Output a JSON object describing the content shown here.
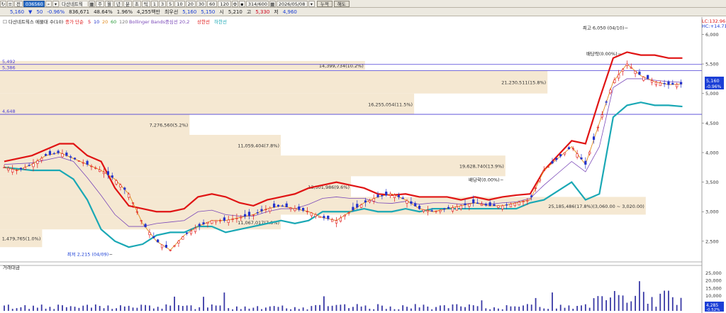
{
  "toolbar": {
    "row1": {
      "period_buttons": [
        "주",
        "월",
        "년",
        "분",
        "초",
        "틱"
      ],
      "interval_buttons": [
        "1",
        "3",
        "5",
        "10",
        "20",
        "30",
        "60",
        "120"
      ],
      "count": "314/600",
      "date": "2026/05/08",
      "btn_sum": "누적",
      "btn_apply": "적용",
      "btn_clear": "해도",
      "stock_code": "036560",
      "stock_name": "다산네트웍",
      "mode": "전"
    },
    "row2": {
      "price": "5,160",
      "change": "50",
      "change_pct": "-0.96%",
      "volume": "836,671",
      "ratio": "48.64%",
      "ratio2": "1.96%",
      "amount": "4,255백만",
      "label_prev": "최우선",
      "best_ask": "5,160",
      "best_bid": "5,150",
      "label_low": "시",
      "open": "5,210",
      "label_high": "고",
      "high": "5,330",
      "label_close": "저",
      "low": "4,960"
    }
  },
  "legend": {
    "title": "다산네트웍스 메물대 수(10)",
    "ma_label": "종가 단순",
    "ma_periods": [
      "5",
      "10",
      "20",
      "60",
      "120"
    ],
    "bb_label": "Bollinger Bands중심선 20,2",
    "bb_upper": "상한선",
    "bb_lower": "하한선"
  },
  "volume_label": "거래대금",
  "right_badges": {
    "top1": "LC:132.96",
    "top2": "HC:+14.71",
    "price": "5,160",
    "pct": "-0.96%",
    "vol_value": "4,285",
    "vol_pct": "-0.52%"
  },
  "colors": {
    "upper_band": "#e01414",
    "lower_band": "#1aa8b5",
    "candle_up": "#e01414",
    "candle_down": "#2233cc",
    "profile": "#f5e8d2",
    "hline": "#4b3fd6"
  },
  "chart_data": {
    "type": "candlestick",
    "y_ticks": [
      "6,000",
      "5,500",
      "5,000",
      "4,500",
      "4,000",
      "3,500",
      "3,000",
      "2,500"
    ],
    "y_range": [
      2150,
      6150
    ],
    "vol_ticks": [
      "25,000",
      "20,000",
      "15,000",
      "10,000",
      "5,000"
    ],
    "vol_range": [
      0,
      28000
    ],
    "hlines": [
      "5,492",
      "5,386",
      "4,648"
    ],
    "volume_profile": [
      {
        "price_top": 5550,
        "price_bot": 5400,
        "label": "14,399,734(10.2%)",
        "rel": 0.52
      },
      {
        "price_top": 5390,
        "price_bot": 5000,
        "label": "21,230,511(15.8%)",
        "rel": 0.78
      },
      {
        "price_top": 5000,
        "price_bot": 4650,
        "label": "16,255,054(11.5%)",
        "rel": 0.59
      },
      {
        "price_top": 4650,
        "price_bot": 4300,
        "label": "7,276,560(5.2%)",
        "rel": 0.27
      },
      {
        "price_top": 4300,
        "price_bot": 3950,
        "label": "11,059,404(7.8%)",
        "rel": 0.4
      },
      {
        "price_top": 3950,
        "price_bot": 3600,
        "label": "19,628,740(13.9%)",
        "rel": 0.72
      },
      {
        "price_top": 3600,
        "price_bot": 3250,
        "label": "13,501,986(9.6%)",
        "rel": 0.5
      },
      {
        "price_top": 3250,
        "price_bot": 2950,
        "label": "25,185,486(17.8%)(3,060.00 ~ 3,020.00)",
        "rel": 0.92
      },
      {
        "price_top": 2950,
        "price_bot": 2700,
        "label": "11,067,017(7.8%)",
        "rel": 0.4
      },
      {
        "price_top": 2700,
        "price_bot": 2400,
        "label": "1,479,765(1.0%)",
        "rel": 0.06
      }
    ],
    "annotations": [
      {
        "text": "최고 6,050 (04/10)",
        "price": 6050,
        "pos": 0.9
      },
      {
        "text": "최저 2,215 (04/09)",
        "price": 2215,
        "pos": 0.155
      },
      {
        "text": "배당락(0.00%)",
        "price": 5610,
        "pos": 0.89
      },
      {
        "text": "배당락(0.00%)",
        "price": 3480,
        "pos": 0.72
      }
    ],
    "price_path": [
      [
        0,
        3750
      ],
      [
        2,
        3700
      ],
      [
        4,
        3800
      ],
      [
        6,
        3950
      ],
      [
        8,
        4000
      ],
      [
        10,
        3900
      ],
      [
        12,
        3800
      ],
      [
        14,
        3700
      ],
      [
        16,
        3550
      ],
      [
        18,
        3300
      ],
      [
        20,
        2800
      ],
      [
        22,
        2500
      ],
      [
        24,
        2350
      ],
      [
        26,
        2600
      ],
      [
        28,
        2750
      ],
      [
        30,
        2850
      ],
      [
        32,
        2850
      ],
      [
        34,
        2900
      ],
      [
        36,
        2950
      ],
      [
        38,
        3050
      ],
      [
        40,
        3100
      ],
      [
        42,
        3050
      ],
      [
        44,
        3000
      ],
      [
        46,
        2900
      ],
      [
        48,
        2850
      ],
      [
        50,
        3000
      ],
      [
        52,
        3150
      ],
      [
        54,
        3250
      ],
      [
        56,
        3300
      ],
      [
        58,
        3200
      ],
      [
        60,
        3050
      ],
      [
        62,
        3000
      ],
      [
        64,
        3050
      ],
      [
        66,
        3100
      ],
      [
        68,
        3150
      ],
      [
        70,
        3100
      ],
      [
        72,
        3100
      ],
      [
        74,
        3150
      ],
      [
        76,
        3200
      ],
      [
        78,
        3700
      ],
      [
        80,
        3900
      ],
      [
        82,
        4100
      ],
      [
        84,
        3800
      ],
      [
        86,
        4500
      ],
      [
        88,
        5200
      ],
      [
        90,
        5500
      ],
      [
        92,
        5300
      ],
      [
        94,
        5200
      ],
      [
        96,
        5150
      ],
      [
        98,
        5160
      ]
    ],
    "upper_band": [
      [
        0,
        3850
      ],
      [
        4,
        3950
      ],
      [
        8,
        4150
      ],
      [
        10,
        4150
      ],
      [
        12,
        3950
      ],
      [
        14,
        3850
      ],
      [
        16,
        3400
      ],
      [
        18,
        3100
      ],
      [
        20,
        3050
      ],
      [
        22,
        3000
      ],
      [
        24,
        3000
      ],
      [
        26,
        3050
      ],
      [
        28,
        3250
      ],
      [
        30,
        3300
      ],
      [
        32,
        3250
      ],
      [
        34,
        3150
      ],
      [
        36,
        3100
      ],
      [
        38,
        3200
      ],
      [
        40,
        3250
      ],
      [
        42,
        3300
      ],
      [
        44,
        3400
      ],
      [
        46,
        3450
      ],
      [
        48,
        3500
      ],
      [
        50,
        3450
      ],
      [
        52,
        3400
      ],
      [
        54,
        3300
      ],
      [
        56,
        3280
      ],
      [
        58,
        3300
      ],
      [
        60,
        3250
      ],
      [
        62,
        3250
      ],
      [
        64,
        3250
      ],
      [
        66,
        3200
      ],
      [
        68,
        3250
      ],
      [
        70,
        3200
      ],
      [
        72,
        3250
      ],
      [
        74,
        3280
      ],
      [
        76,
        3300
      ],
      [
        78,
        3700
      ],
      [
        80,
        3950
      ],
      [
        82,
        4200
      ],
      [
        84,
        4150
      ],
      [
        86,
        4900
      ],
      [
        88,
        5600
      ],
      [
        90,
        5700
      ],
      [
        92,
        5650
      ],
      [
        94,
        5650
      ],
      [
        96,
        5600
      ],
      [
        98,
        5600
      ]
    ],
    "lower_band": [
      [
        0,
        3750
      ],
      [
        4,
        3700
      ],
      [
        8,
        3700
      ],
      [
        10,
        3550
      ],
      [
        12,
        3200
      ],
      [
        14,
        2700
      ],
      [
        16,
        2500
      ],
      [
        18,
        2400
      ],
      [
        20,
        2450
      ],
      [
        22,
        2600
      ],
      [
        24,
        2650
      ],
      [
        26,
        2650
      ],
      [
        28,
        2750
      ],
      [
        30,
        2750
      ],
      [
        32,
        2650
      ],
      [
        34,
        2700
      ],
      [
        36,
        2750
      ],
      [
        38,
        2800
      ],
      [
        40,
        2850
      ],
      [
        42,
        2800
      ],
      [
        44,
        2850
      ],
      [
        46,
        3000
      ],
      [
        48,
        3000
      ],
      [
        50,
        3000
      ],
      [
        52,
        3050
      ],
      [
        54,
        3000
      ],
      [
        56,
        3000
      ],
      [
        58,
        3050
      ],
      [
        60,
        3000
      ],
      [
        62,
        3050
      ],
      [
        64,
        3050
      ],
      [
        66,
        3050
      ],
      [
        68,
        3050
      ],
      [
        70,
        3050
      ],
      [
        72,
        3050
      ],
      [
        74,
        3050
      ],
      [
        76,
        3150
      ],
      [
        78,
        3200
      ],
      [
        80,
        3350
      ],
      [
        82,
        3500
      ],
      [
        84,
        3200
      ],
      [
        86,
        3300
      ],
      [
        88,
        4600
      ],
      [
        90,
        4800
      ],
      [
        92,
        4850
      ],
      [
        94,
        4800
      ],
      [
        96,
        4800
      ],
      [
        98,
        4780
      ]
    ]
  }
}
